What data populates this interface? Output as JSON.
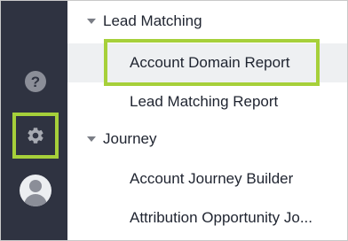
{
  "rail": {
    "help_icon_glyph": "?",
    "highlight_color": "#a6d03a",
    "background": "#2f3341",
    "icons": [
      "question-circle-icon",
      "gear-icon",
      "user-avatar-icon"
    ]
  },
  "tree": {
    "groups": [
      {
        "label": "Lead Matching",
        "expanded": true,
        "items": [
          {
            "label": "Account Domain Report",
            "selected": true
          },
          {
            "label": "Lead Matching Report",
            "selected": false
          }
        ]
      },
      {
        "label": "Journey",
        "expanded": true,
        "items": [
          {
            "label": "Account Journey Builder",
            "selected": false
          },
          {
            "label": "Attribution Opportunity Jo...",
            "selected": false
          }
        ]
      }
    ]
  }
}
